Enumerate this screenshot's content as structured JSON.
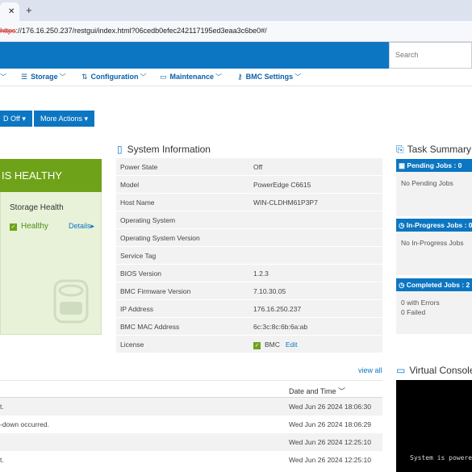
{
  "browser": {
    "url_protocol": "https",
    "url_rest": "://176.16.250.237/restgui/index.html?06cedb0efec242117195ed3eaa3c6be0#/"
  },
  "header": {
    "search_placeholder": "Search"
  },
  "nav": {
    "storage": "Storage",
    "configuration": "Configuration",
    "maintenance": "Maintenance",
    "bmc_settings": "BMC Settings"
  },
  "actions": {
    "power_label": "D Off",
    "more_actions": "More Actions"
  },
  "health": {
    "banner": "IS HEALTHY",
    "storage_title": "Storage Health",
    "storage_status": "Healthy",
    "details": "Details"
  },
  "system_info": {
    "title": "System Information",
    "rows": [
      {
        "label": "Power State",
        "value": "Off"
      },
      {
        "label": "Model",
        "value": "PowerEdge C6615"
      },
      {
        "label": "Host Name",
        "value": "WIN-CLDHM61P3P7"
      },
      {
        "label": "Operating System",
        "value": ""
      },
      {
        "label": "Operating System Version",
        "value": ""
      },
      {
        "label": "Service Tag",
        "value": ""
      },
      {
        "label": "BIOS Version",
        "value": "1.2.3"
      },
      {
        "label": "BMC Firmware Version",
        "value": "7.10.30.05"
      },
      {
        "label": "IP Address",
        "value": "176.16.250.237"
      },
      {
        "label": "BMC MAC Address",
        "value": "6c:3c:8c:6b:6a:ab"
      }
    ],
    "license_label": "License",
    "license_value": "BMC",
    "license_edit": "Edit"
  },
  "logs": {
    "view_all": "view all",
    "date_header": "Date and Time",
    "rows": [
      {
        "message": "t.",
        "datetime": "Wed Jun 26 2024 18:06:30"
      },
      {
        "message": "-down occurred.",
        "datetime": "Wed Jun 26 2024 18:06:29"
      },
      {
        "message": "",
        "datetime": "Wed Jun 26 2024 12:25:10"
      },
      {
        "message": "t.",
        "datetime": "Wed Jun 26 2024 12:25:10"
      }
    ]
  },
  "tasks": {
    "title": "Task Summary",
    "pending_header": "Pending Jobs : 0",
    "pending_body": "No Pending Jobs",
    "inprogress_header": "In-Progress Jobs : 0",
    "inprogress_body": "No In-Progress Jobs",
    "completed_header": "Completed Jobs : 2",
    "completed_errors": "0 with Errors",
    "completed_failed": "0 Failed"
  },
  "virtual_console": {
    "title": "Virtual Console",
    "screen_text": "System is powered o"
  },
  "colors": {
    "accent": "#0c76c2",
    "healthy": "#6ea319",
    "panel_bg": "#f2f2f2"
  }
}
